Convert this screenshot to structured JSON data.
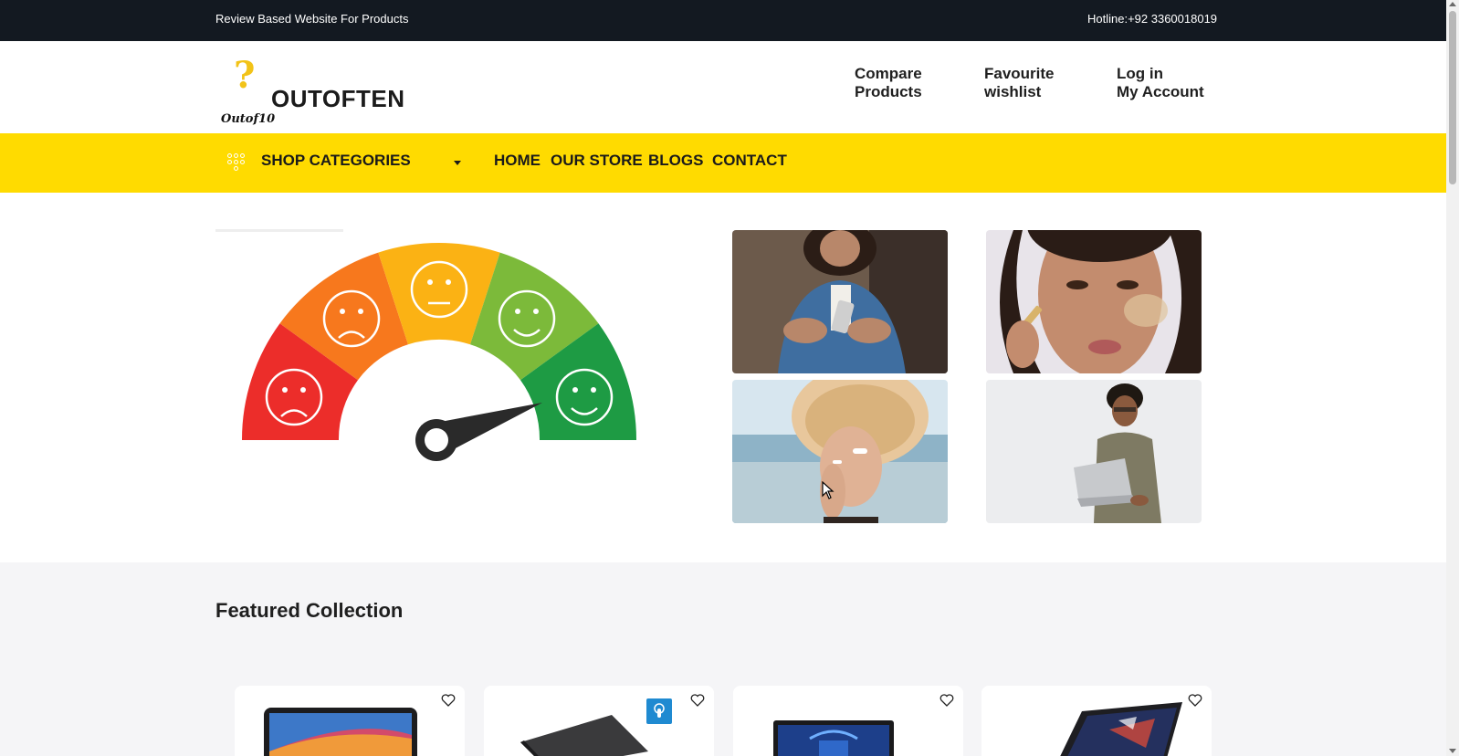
{
  "topbar": {
    "tagline": "Review Based Website For Products",
    "hotline": "Hotline:+92 3360018019"
  },
  "header": {
    "logo_script": "Outof10",
    "logo_text": "OUTOFTEN",
    "links": [
      {
        "line1": "Compare",
        "line2": "Products"
      },
      {
        "line1": "Favourite",
        "line2": "wishlist"
      },
      {
        "line1": "Log in",
        "line2": "My Account"
      }
    ]
  },
  "nav": {
    "shop_categories": "SHOP CATEGORIES",
    "items": [
      "HOME",
      "OUR STORE",
      "BLOGS",
      "CONTACT"
    ]
  },
  "hero": {
    "gauge_icon": "satisfaction-gauge",
    "thumbnails": [
      "woman-with-phone",
      "woman-applying-serum",
      "woman-applying-sunscreen",
      "man-with-laptop"
    ]
  },
  "featured": {
    "title": "Featured Collection",
    "cards": [
      "laptop-macbook",
      "laptop-dark-touch",
      "laptop-windows",
      "laptop-thin-dark"
    ]
  },
  "colors": {
    "topbar": "#131921",
    "navbar": "#ffdb00",
    "featured_bg": "#f5f5f7"
  }
}
